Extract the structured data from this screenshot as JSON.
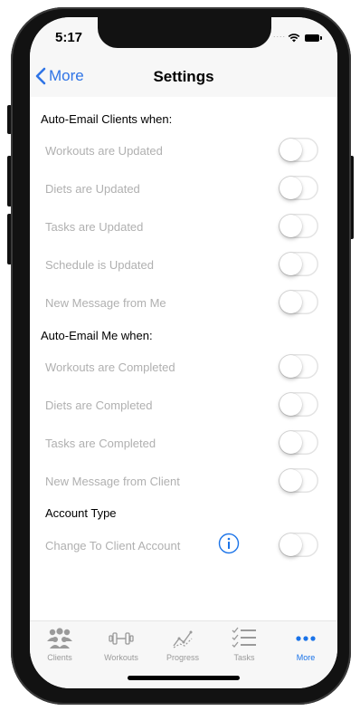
{
  "status": {
    "time": "5:17",
    "signal": "...."
  },
  "nav": {
    "back_label": "More",
    "title": "Settings"
  },
  "sections": {
    "clients": {
      "title": "Auto-Email Clients when:",
      "rows": [
        {
          "label": "Workouts are Updated",
          "on": false
        },
        {
          "label": "Diets are Updated",
          "on": false
        },
        {
          "label": "Tasks are Updated",
          "on": false
        },
        {
          "label": "Schedule is Updated",
          "on": false
        },
        {
          "label": "New Message from Me",
          "on": false
        }
      ]
    },
    "me": {
      "title": "Auto-Email Me when:",
      "rows": [
        {
          "label": "Workouts are Completed",
          "on": false
        },
        {
          "label": "Diets are Completed",
          "on": false
        },
        {
          "label": "Tasks are Completed",
          "on": false
        },
        {
          "label": "New Message from Client",
          "on": false
        }
      ]
    },
    "account": {
      "title": "Account Type",
      "rows": [
        {
          "label": "Change To Client Account",
          "on": false,
          "icon": "info-icon"
        }
      ]
    }
  },
  "tabs": [
    {
      "label": "Clients",
      "icon": "clients-icon",
      "active": false
    },
    {
      "label": "Workouts",
      "icon": "dumbbell-icon",
      "active": false
    },
    {
      "label": "Progress",
      "icon": "progress-chart-icon",
      "active": false
    },
    {
      "label": "Tasks",
      "icon": "checklist-icon",
      "active": false
    },
    {
      "label": "More",
      "icon": "more-icon",
      "active": true
    }
  ],
  "colors": {
    "accent": "#1a73e8",
    "muted_text": "#b0b0b0",
    "bar_bg": "#f7f7f7"
  }
}
